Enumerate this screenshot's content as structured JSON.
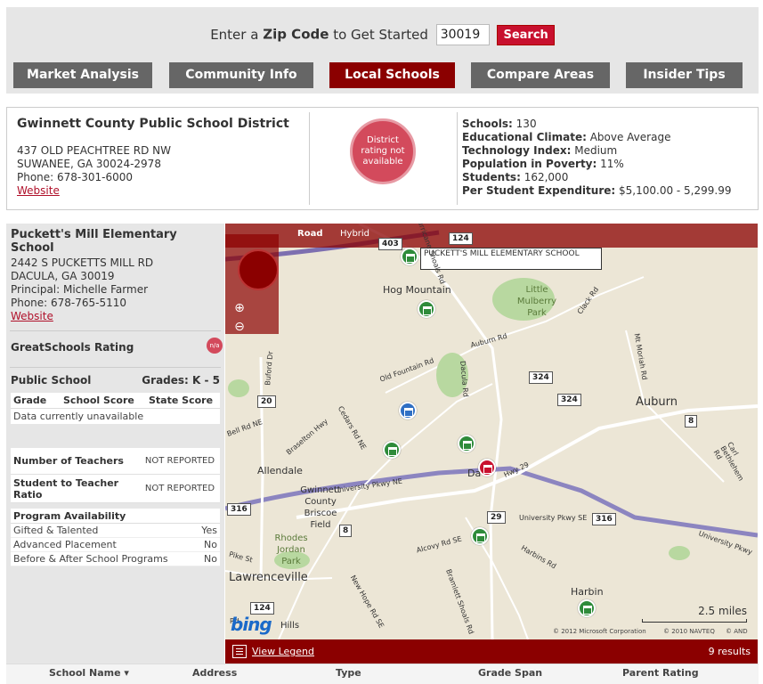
{
  "search": {
    "prefix": "Enter a",
    "bold": "Zip Code",
    "suffix": "to Get Started",
    "zip_value": "30019",
    "button": "Search"
  },
  "tabs": [
    {
      "label": "Market Analysis",
      "active": false
    },
    {
      "label": "Community Info",
      "active": false
    },
    {
      "label": "Local Schools",
      "active": true
    },
    {
      "label": "Compare Areas",
      "active": false
    },
    {
      "label": "Insider Tips",
      "active": false
    }
  ],
  "district": {
    "name": "Gwinnett County Public School District",
    "address1": "437 OLD PEACHTREE RD NW",
    "address2": "SUWANEE, GA 30024-2978",
    "phone": "Phone: 678-301-6000",
    "website": "Website",
    "rating_badge": "District rating not available",
    "stats": [
      {
        "label": "Schools:",
        "value": "130"
      },
      {
        "label": "Educational Climate:",
        "value": "Above Average"
      },
      {
        "label": "Technology Index:",
        "value": "Medium"
      },
      {
        "label": "Population in Poverty:",
        "value": "11%"
      },
      {
        "label": "Students:",
        "value": "162,000"
      },
      {
        "label": "Per Student Expenditure:",
        "value": "$5,100.00 - 5,299.99"
      }
    ]
  },
  "school": {
    "name": "Puckett's Mill Elementary School",
    "address1": "2442 S PUCKETTS MILL RD",
    "address2": "DACULA, GA 30019",
    "principal": "Principal: Michelle Farmer",
    "phone": "Phone: 678-765-5110",
    "website": "Website",
    "gs_rating_label": "GreatSchools Rating",
    "gs_badge": "n/a",
    "type": "Public School",
    "grades": "Grades: K - 5",
    "score_headers": [
      "Grade",
      "School Score",
      "State Score"
    ],
    "score_empty": "Data currently unavailable",
    "teachers_label": "Number of Teachers",
    "teachers_value": "NOT REPORTED",
    "ratio_label": "Student to Teacher Ratio",
    "ratio_value": "NOT REPORTED",
    "programs_header": "Program Availability",
    "programs": [
      {
        "name": "Gifted & Talented",
        "value": "Yes"
      },
      {
        "name": "Advanced Placement",
        "value": "No"
      },
      {
        "name": "Before & After School Programs",
        "value": "No"
      }
    ]
  },
  "map": {
    "tab_road": "Road",
    "tab_hybrid": "Hybrid",
    "pin_label": "PUCKETT'S MILL ELEMENTARY SCHOOL",
    "towns": [
      "Hog Mountain",
      "Little Mulberry Park",
      "Auburn",
      "Allendale",
      "Gwinnett County Briscoe Field",
      "Rhodes Jordan Park",
      "Lawrenceville",
      "Harbin",
      "Da"
    ],
    "roads": [
      "Old Fountain Rd",
      "Auburn Rd",
      "Dacula Rd",
      "Buford Dr",
      "Bell Rd NE",
      "Braselton Hwy",
      "Cedars Rd NE",
      "University Pkwy NE",
      "Alcovy Rd SE",
      "Harbins Rd",
      "Hwy 29",
      "University Pkwy SE",
      "University Pkwy",
      "Mt Moriah Rd",
      "Carl Bethlehem Rd",
      "Clack Rd",
      "New Hope Rd SE",
      "Hurricane Shoals Rd",
      "Bramlett Shoals Rd",
      "Pike St",
      "Rd",
      "Hills"
    ],
    "shields": [
      "403",
      "124",
      "324",
      "324",
      "20",
      "8",
      "316",
      "8",
      "29",
      "316",
      "124"
    ],
    "scale": "2.5 miles",
    "brand": "bing",
    "copyright1": "© 2012 Microsoft Corporation",
    "copyright2": "© 2010 NAVTEQ",
    "copyright3": "© AND"
  },
  "mapbar": {
    "legend": "View Legend",
    "results": "9 results"
  },
  "columns": [
    "School Name ▾",
    "Address",
    "Type",
    "Grade Span",
    "Parent Rating"
  ],
  "colors": {
    "accent": "#c8102e",
    "dark_red": "#8b0000",
    "tab_gray": "#666666"
  }
}
